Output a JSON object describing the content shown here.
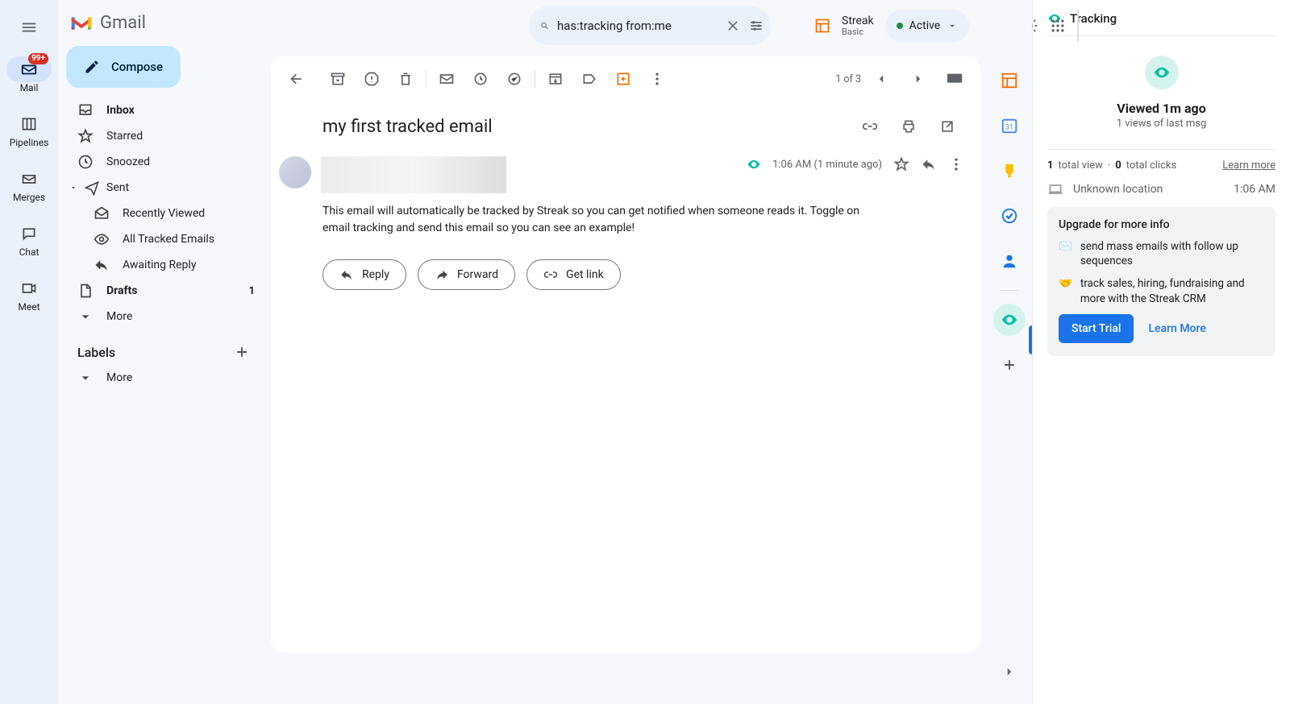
{
  "app": {
    "name": "Gmail"
  },
  "mini_rail": {
    "badge": "99+",
    "items": [
      {
        "label": "Mail"
      },
      {
        "label": "Pipelines"
      },
      {
        "label": "Merges"
      },
      {
        "label": "Chat"
      },
      {
        "label": "Meet"
      }
    ]
  },
  "compose_label": "Compose",
  "nav": {
    "inbox": "Inbox",
    "starred": "Starred",
    "snoozed": "Snoozed",
    "sent": "Sent",
    "recently_viewed": "Recently Viewed",
    "all_tracked": "All Tracked Emails",
    "awaiting_reply": "Awaiting Reply",
    "drafts": "Drafts",
    "drafts_count": "1",
    "more": "More"
  },
  "labels": {
    "header": "Labels",
    "more": "More"
  },
  "search": {
    "query": "has:tracking from:me"
  },
  "streak": {
    "name": "Streak",
    "plan": "Basic",
    "status": "Active"
  },
  "toolbar": {
    "count": "1 of 3"
  },
  "email": {
    "subject": "my first tracked email",
    "time": "1:06 AM (1 minute ago)",
    "body": "This email will automatically be tracked by Streak so you can get notified when someone reads it. Toggle on email tracking and send this email so you can see an example!",
    "reply": "Reply",
    "forward": "Forward",
    "get_link": "Get link"
  },
  "tracking": {
    "title": "Tracking",
    "viewed": "Viewed 1m ago",
    "views_line": "1 views of last msg",
    "total_views_n": "1",
    "total_views_label": "total view",
    "total_clicks_n": "0",
    "total_clicks_label": "total clicks",
    "learn_more_link": "Learn more",
    "location": "Unknown location",
    "location_time": "1:06 AM",
    "upgrade_header": "Upgrade for more info",
    "upgrade_item1": "send mass emails with follow up sequences",
    "upgrade_item2": "track sales, hiring, fundraising and more with the Streak CRM",
    "start_trial": "Start Trial",
    "learn_more_btn": "Learn More"
  }
}
